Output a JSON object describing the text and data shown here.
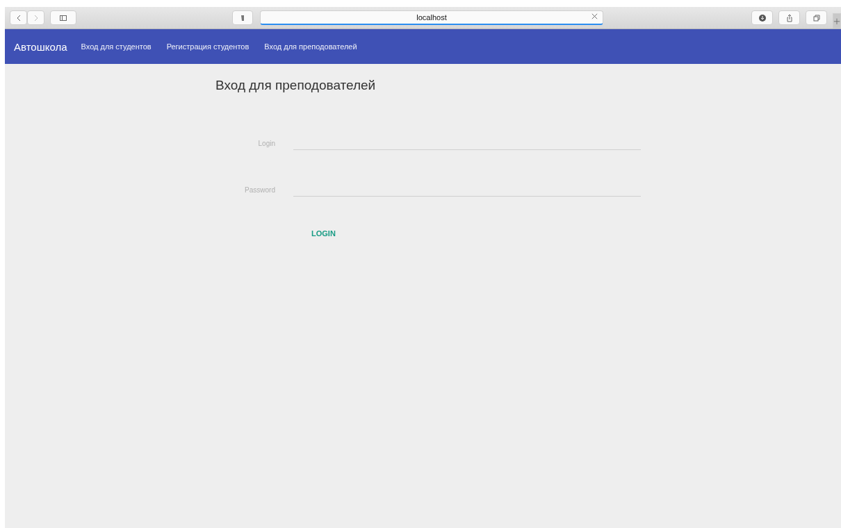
{
  "browser": {
    "address": "localhost"
  },
  "navbar": {
    "brand": "Автошкола",
    "links": [
      {
        "label": "Вход для студентов",
        "selected": false
      },
      {
        "label": "Регистрация студентов",
        "selected": false
      },
      {
        "label": "Вход для преподователей",
        "selected": false
      }
    ]
  },
  "form": {
    "title": "Вход для преподователей",
    "fields": [
      {
        "label": "Login"
      },
      {
        "label": "Password"
      }
    ],
    "button": "LOGIN"
  }
}
